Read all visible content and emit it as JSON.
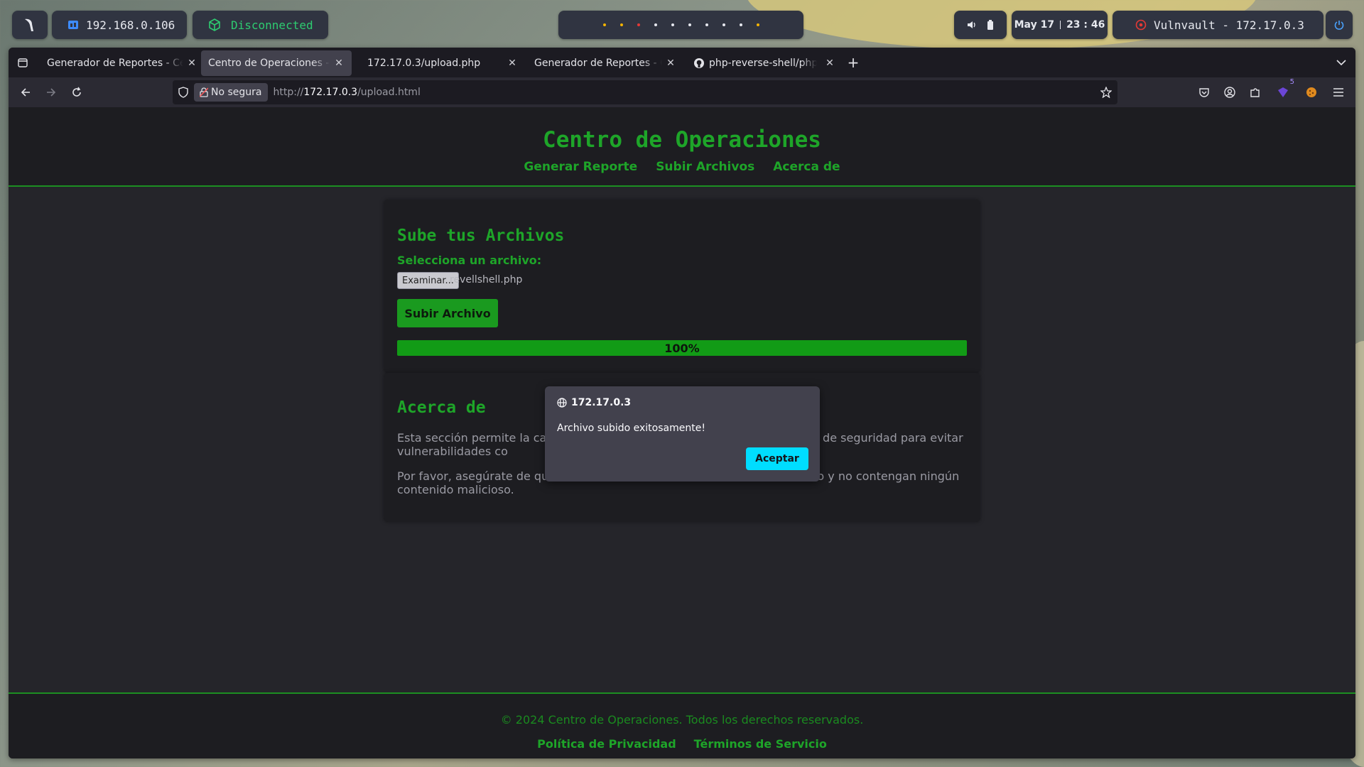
{
  "topbar": {
    "ip_label": "192.168.0.106",
    "vpn_status": "Disconnected",
    "clock_date": "May 17",
    "clock_time": "23 : 46",
    "target_label": "Vulnvault - 172.17.0.3",
    "colors": {
      "accent_green": "#2ecc71",
      "target_red": "#e53935",
      "workspace_active": "#f5b400"
    }
  },
  "browser": {
    "tabs": [
      {
        "label": "Generador de Reportes - Centro de Operaciones",
        "active": false,
        "icon": "none"
      },
      {
        "label": "Centro de Operaciones - Subir Archivos",
        "active": true,
        "icon": "none"
      },
      {
        "label": "172.17.0.3/upload.php",
        "active": false,
        "icon": "none"
      },
      {
        "label": "Generador de Reportes - Centro de Operaciones",
        "active": false,
        "icon": "none"
      },
      {
        "label": "php-reverse-shell/php-reverse-shell.php",
        "active": false,
        "icon": "github-icon"
      }
    ],
    "security_label": "No segura",
    "url_prefix": "http://",
    "url_host": "172.17.0.3",
    "url_path": "/upload.html",
    "extensions_badge": "5"
  },
  "page": {
    "site_title": "Centro de Operaciones",
    "nav": [
      "Generar Reporte",
      "Subir Archivos",
      "Acerca de"
    ],
    "upload": {
      "heading": "Sube tus Archivos",
      "select_label": "Selecciona un archivo:",
      "browse_button": "Examinar...",
      "file_name": "revellshell.php",
      "submit_button": "Subir Archivo",
      "progress_value": 1.0,
      "progress_text": "100%"
    },
    "about": {
      "heading": "Acerca de",
      "paragraph1": "Esta sección permite la ca                                                                   didas de seguridad para evitar vulnerabilidades co",
      "paragraph2": "Por favor, asegúrate de qu                                                                   rrecto y no contengan ningún contenido malicioso."
    },
    "footer": {
      "copyright": "© 2024 Centro de Operaciones. Todos los derechos reservados.",
      "links": [
        "Política de Privacidad",
        "Términos de Servicio"
      ]
    }
  },
  "dialog": {
    "host": "172.17.0.3",
    "message": "Archivo subido exitosamente!",
    "ok_button": "Aceptar"
  }
}
